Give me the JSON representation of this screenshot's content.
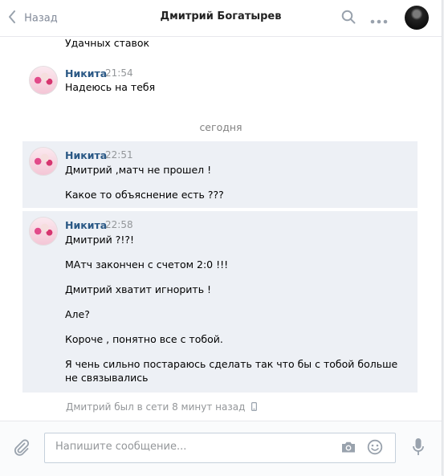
{
  "header": {
    "back_label": "Назад",
    "title": "Дмитрий Богатырев",
    "icons": [
      "chevron-left-icon",
      "search-icon",
      "more-icon",
      "avatar"
    ]
  },
  "feed": {
    "top_partial": "Удачных ставок",
    "msg1": {
      "author": "Никита",
      "time": "21:54",
      "lines": [
        "Надеюсь на тебя"
      ]
    },
    "divider": "сегодня",
    "msg2": {
      "author": "Никита",
      "time": "22:51",
      "lines": [
        "Дмитрий ,матч не прошел !",
        "Какое то объяснение есть ???"
      ]
    },
    "msg3": {
      "author": "Никита",
      "time": "22:58",
      "lines": [
        "Дмитрий ?!?!",
        "МАтч закончен с счетом 2:0 !!!",
        "Дмитрий хватит игнорить !",
        "Але?",
        "Короче , понятно все с тобой.",
        "Я чень сильно постараюсь сделать так что бы с тобой больше",
        "не связывались"
      ]
    },
    "status": "Дмитрий был в сети 8 минут назад"
  },
  "composer": {
    "placeholder": "Напишите сообщение..."
  },
  "colors": {
    "link": "#2a5885",
    "muted": "#939699",
    "selected_bg": "#edf0f5",
    "border": "#c5d0db"
  }
}
